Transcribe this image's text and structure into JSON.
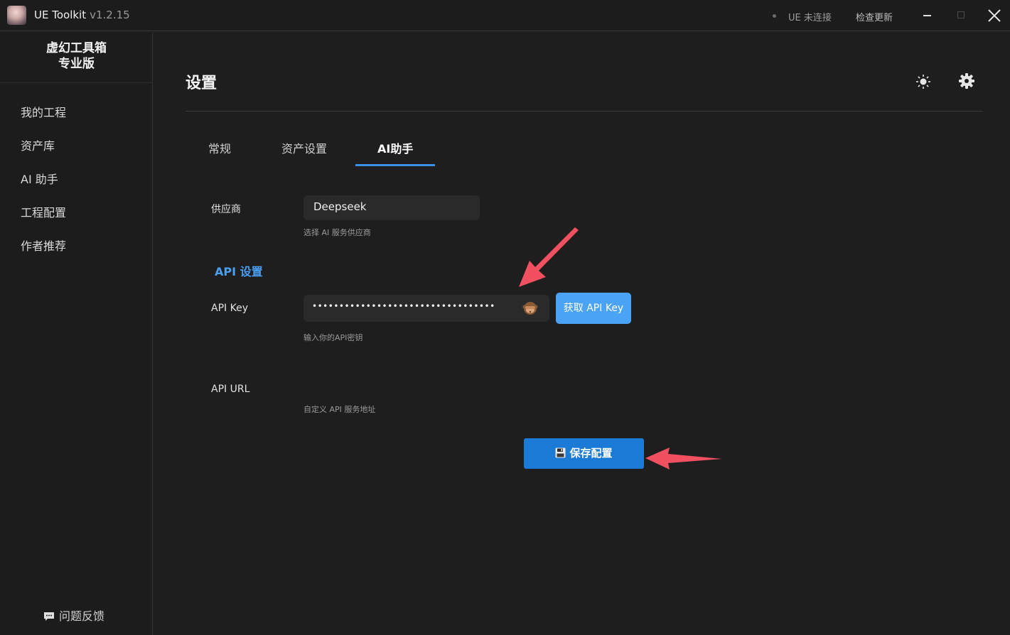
{
  "window": {
    "app_name": "UE Toolkit",
    "version": "v1.2.15",
    "status": "UE 未连接",
    "check_update": "检查更新"
  },
  "sidebar": {
    "brand_line1": "虚幻工具箱",
    "brand_line2": "专业版",
    "items": [
      {
        "label": "我的工程"
      },
      {
        "label": "资产库"
      },
      {
        "label": "AI 助手"
      },
      {
        "label": "工程配置"
      },
      {
        "label": "作者推荐"
      }
    ],
    "feedback": "问题反馈"
  },
  "main": {
    "title": "设置",
    "tabs": [
      {
        "label": "常规"
      },
      {
        "label": "资产设置"
      },
      {
        "label": "AI助手",
        "active": true
      }
    ],
    "provider": {
      "label": "供应商",
      "value": "Deepseek",
      "hint": "选择 AI 服务供应商"
    },
    "api_section": {
      "title": "API 设置",
      "key_label": "API Key",
      "key_value": "••••••••••••••••••••••••••••••••••",
      "key_hint": "输入你的API密钥",
      "get_key_button": "获取 API Key",
      "url_label": "API URL",
      "url_hint": "自定义 API 服务地址"
    },
    "save_button": "保存配置"
  },
  "colors": {
    "accent": "#3b8fe4",
    "save_button": "#1a7ad6",
    "get_key_button": "#4aa3f5",
    "annotation_arrow": "#f0505f"
  }
}
